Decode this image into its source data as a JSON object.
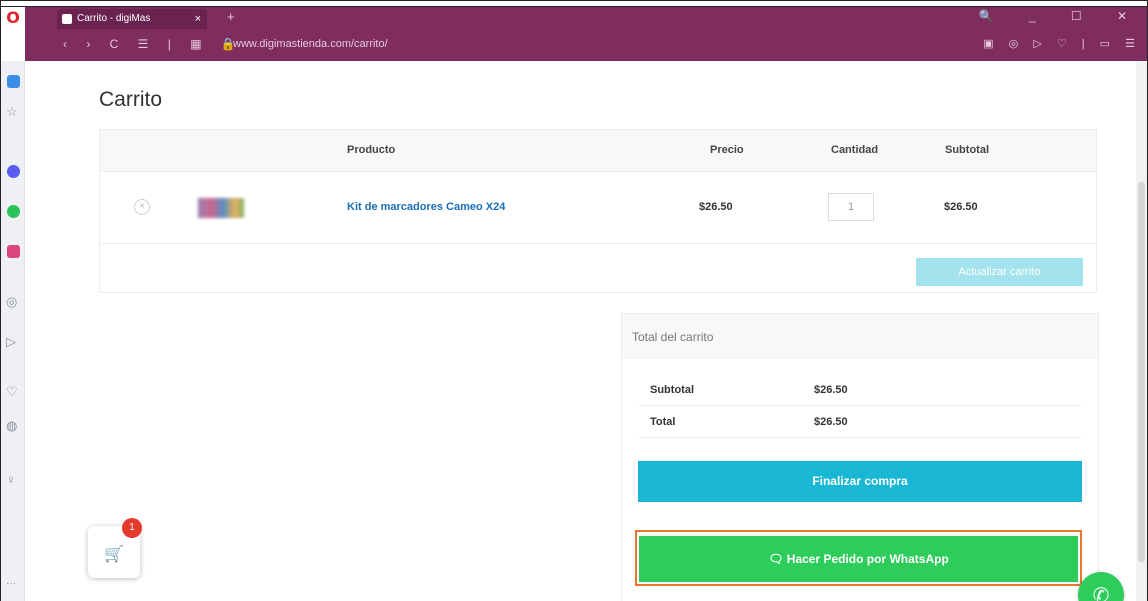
{
  "browser": {
    "tab_title": "Carrito - digiMas",
    "tab_close": "×",
    "new_tab": "+",
    "window_controls": "🔍 _ ☐ ✕",
    "nav_controls": "‹ › C ☰ | ▦ 🔒",
    "url": "www.digimastienda.com/carrito/",
    "extension_icons": "▣ ◎ ▷ ♡ | ▭ ☰"
  },
  "page": {
    "title": "Carrito",
    "table": {
      "headers": {
        "product": "Producto",
        "price": "Precio",
        "quantity": "Cantidad",
        "subtotal": "Subtotal"
      },
      "rows": [
        {
          "remove": "×",
          "name": "Kit de marcadores Cameo X24",
          "price": "$26.50",
          "quantity": "1",
          "subtotal": "$26.50"
        }
      ],
      "update_button": "Actualizar carrito"
    },
    "totals": {
      "title": "Total del carrito",
      "subtotal_label": "Subtotal",
      "subtotal_value": "$26.50",
      "total_label": "Total",
      "total_value": "$26.50",
      "checkout_button": "Finalizar compra",
      "whatsapp_button": "🗨  Hacer Pedido por WhatsApp"
    },
    "floating_cart": {
      "count": "1"
    }
  },
  "colors": {
    "browser_chrome": "#7e2d5e",
    "checkout": "#19b7d4",
    "whatsapp": "#2ecc5a",
    "highlight": "#e8762b",
    "badge": "#e5392b"
  }
}
